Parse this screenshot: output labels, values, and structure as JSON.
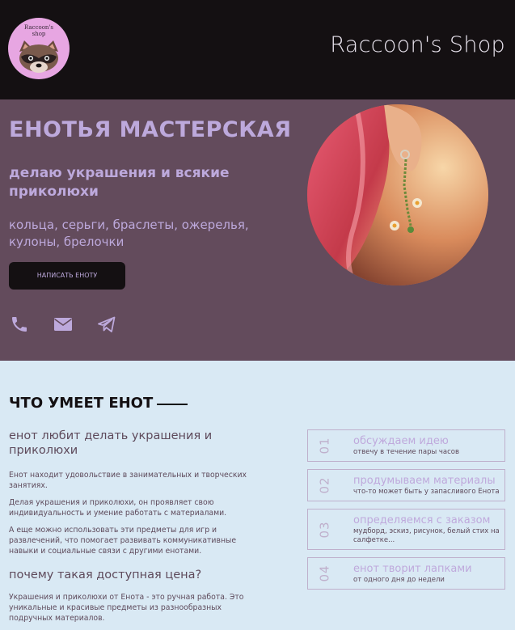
{
  "header": {
    "logo_text_line1": "Raccoon's",
    "logo_text_line2": "shop",
    "brand": "Raccoon's Shop"
  },
  "hero": {
    "title": "ЕНОТЬЯ МАСТЕРСКАЯ",
    "subtitle": "делаю украшения и всякие приколюхи",
    "description": "кольца, серьги, браслеты, ожерелья, кулоны, брелочки",
    "cta_label": "НАПИСАТЬ ЕНОТУ",
    "icons": [
      "phone-icon",
      "mail-icon",
      "telegram-icon"
    ]
  },
  "skills": {
    "title": "ЧТО УМЕЕТ ЕНОТ",
    "heading1": "енот любит делать украшения и приколюхи",
    "paragraph1": "Енот находит удовольствие в занимательных и творческих занятиях.",
    "paragraph2": "Делая украшения и приколюхи, он проявляет свою индивидуальность и умение работать с материалами.",
    "paragraph3": "А еще можно использовать эти предметы для игр и развлечений, что помогает развивать коммуникативные навыки и социальные связи с другими енотами.",
    "heading2": "почему такая доступная цена?",
    "paragraph4": "Украшения и приколюхи от Енота - это ручная работа. Это уникальные и красивые предметы из разнообразных подручных материалов."
  },
  "steps": [
    {
      "num": "01",
      "title": "обсуждаем идею",
      "desc": "отвечу в течение пары часов"
    },
    {
      "num": "02",
      "title": "продумываем материалы",
      "desc": "что-то может быть у запасливого Енота"
    },
    {
      "num": "03",
      "title": "определяемся с заказом",
      "desc": "мудборд, эскиз, рисунок, белый стих на салфетке..."
    },
    {
      "num": "04",
      "title": "енот творит лапками",
      "desc": "от одного дня до недели"
    }
  ],
  "colors": {
    "header_bg": "#141012",
    "hero_bg": "#634b5c",
    "accent_lavender": "#bda9dc",
    "page_bg": "#d9e9f4",
    "text_dark": "#5e4a5b"
  }
}
